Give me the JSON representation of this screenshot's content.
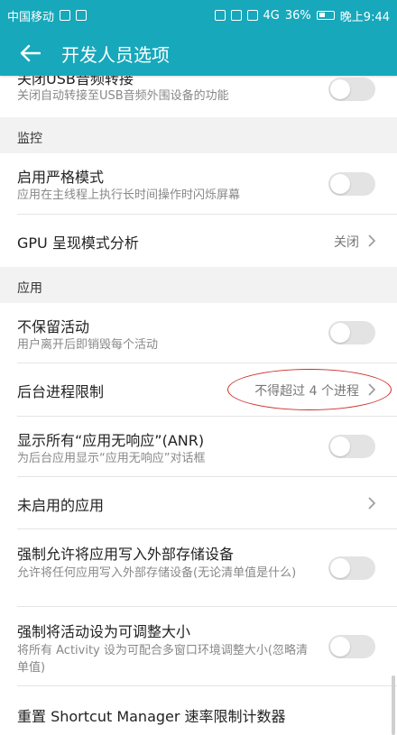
{
  "status": {
    "carrier": "中国移动",
    "signal": "4G",
    "battery": "36%",
    "time": "晚上9:44"
  },
  "appbar": {
    "title": "开发人员选项"
  },
  "items": {
    "usb_audio": {
      "title": "关闭USB音频转接",
      "sub": "关闭自动转接至USB音频外围设备的功能"
    },
    "section_monitor": "监控",
    "strict_mode": {
      "title": "启用严格模式",
      "sub": "应用在主线程上执行长时间操作时闪烁屏幕"
    },
    "gpu_profile": {
      "title": "GPU 呈现模式分析",
      "value": "关闭"
    },
    "section_apps": "应用",
    "dont_keep": {
      "title": "不保留活动",
      "sub": "用户离开后即销毁每个活动"
    },
    "bg_limit": {
      "title": "后台进程限制",
      "value": "不得超过 4 个进程"
    },
    "anr": {
      "title": "显示所有“应用无响应”(ANR)",
      "sub": "为后台应用显示“应用无响应”对话框"
    },
    "inactive_apps": {
      "title": "未启用的应用"
    },
    "force_external": {
      "title": "强制允许将应用写入外部存储设备",
      "sub": "允许将任何应用写入外部存储设备(无论清单值是什么)"
    },
    "force_resizable": {
      "title": "强制将活动设为可调整大小",
      "sub": "将所有 Activity 设为可配合多窗口环境调整大小(忽略清单值)"
    },
    "reset_shortcut": {
      "title": "重置 Shortcut Manager 速率限制计数器"
    }
  }
}
